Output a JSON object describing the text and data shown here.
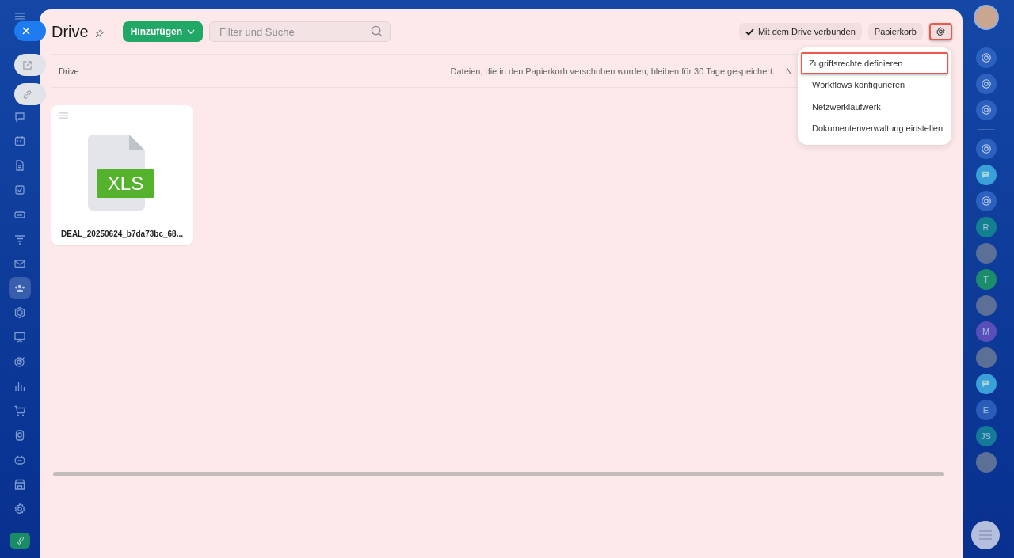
{
  "sidebar": {
    "items": [
      {
        "selected": false
      },
      {
        "selected": false
      },
      {
        "selected": false
      },
      {
        "selected": false
      },
      {
        "selected": false
      },
      {
        "selected": false
      },
      {
        "selected": false
      },
      {
        "selected": true
      },
      {
        "selected": false
      },
      {
        "selected": false
      },
      {
        "selected": false
      },
      {
        "selected": false
      },
      {
        "selected": false
      },
      {
        "selected": false
      },
      {
        "selected": false
      },
      {
        "selected": false
      },
      {
        "selected": false
      }
    ]
  },
  "header": {
    "title": "Drive",
    "add_button": "Hinzufügen",
    "search": {
      "placeholder": "Filter und Suche"
    },
    "connected_chip": {
      "label": "Mit dem Drive verbunden",
      "checked": true
    },
    "trash_button": "Papierkorb",
    "settings_button": {
      "highlighted": true
    }
  },
  "breadcrumb": "Drive",
  "notice": "Dateien, die in den Papierkorb verschoben wurden, bleiben für 30 Tage gespeichert.",
  "notice_cut": "N",
  "files": [
    {
      "type_label": "XLS",
      "name": "DEAL_20250624_b7da73bc_68..."
    }
  ],
  "settings_menu": {
    "items": [
      {
        "label": "Zugriffsrechte definieren",
        "highlighted": true
      },
      {
        "label": "Workflows konfigurieren",
        "highlighted": false
      },
      {
        "label": "Netzwerklaufwerk",
        "highlighted": false
      },
      {
        "label": "Dokumentenverwaltung einstellen",
        "highlighted": false
      }
    ]
  },
  "right_rail": {
    "items": [
      {
        "kind": "icon"
      },
      {
        "kind": "icon"
      },
      {
        "kind": "icon"
      },
      {
        "kind": "divider"
      },
      {
        "kind": "icon"
      },
      {
        "kind": "chat"
      },
      {
        "kind": "icon"
      },
      {
        "kind": "letter",
        "text": "R",
        "color": "#13808f"
      },
      {
        "kind": "photo"
      },
      {
        "kind": "letter",
        "text": "T",
        "color": "#1b8d6a"
      },
      {
        "kind": "photo"
      },
      {
        "kind": "letter",
        "text": "M",
        "color": "#5a4fb8"
      },
      {
        "kind": "photo"
      },
      {
        "kind": "chat"
      },
      {
        "kind": "letter",
        "text": "E",
        "color": "#2a5db8"
      },
      {
        "kind": "letter",
        "text": "JS",
        "color": "#137a98"
      },
      {
        "kind": "photo"
      }
    ]
  }
}
